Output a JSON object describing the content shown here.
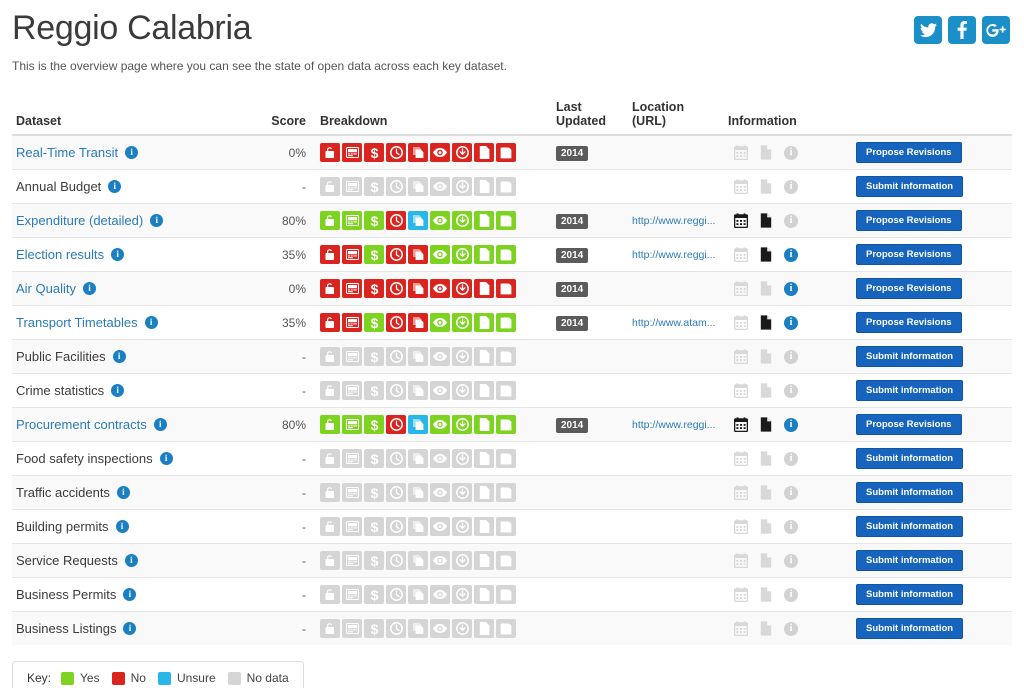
{
  "header": {
    "title": "Reggio Calabria",
    "intro": "This is the overview page where you can see the state of open data across each key dataset.",
    "social": [
      {
        "name": "twitter-icon",
        "label": "Twitter"
      },
      {
        "name": "facebook-icon",
        "label": "Facebook"
      },
      {
        "name": "googleplus-icon",
        "label": "Google Plus"
      }
    ]
  },
  "colors": {
    "yes": "#7ed321",
    "no": "#d9241f",
    "unsure": "#29b6e8",
    "none": "#d5d5d5",
    "accent": "#1664bd",
    "link": "#2b7bb9"
  },
  "table": {
    "columns": [
      {
        "key": "dataset",
        "label": "Dataset"
      },
      {
        "key": "score",
        "label": "Score"
      },
      {
        "key": "breakdown",
        "label": "Breakdown"
      },
      {
        "key": "updated",
        "label": "Last Updated"
      },
      {
        "key": "url",
        "label": "Location (URL)"
      },
      {
        "key": "information",
        "label": "Information"
      },
      {
        "key": "action",
        "label": ""
      }
    ],
    "breakdown_icons": [
      "padlock-open-icon",
      "machine-readable-icon",
      "dollar-icon",
      "clock-icon",
      "license-copy-icon",
      "eye-icon",
      "download-icon",
      "document-icon",
      "save-disk-icon"
    ],
    "rows": [
      {
        "dataset": "Real-Time Transit",
        "is_link": true,
        "score": "0%",
        "breakdown": [
          "no",
          "no",
          "no",
          "no",
          "no",
          "no",
          "no",
          "no",
          "no"
        ],
        "updated": "2014",
        "url": "",
        "information": [
          "off",
          "off",
          "off"
        ],
        "action": "Propose Revisions"
      },
      {
        "dataset": "Annual Budget",
        "is_link": false,
        "score": "-",
        "breakdown": [
          "none",
          "none",
          "none",
          "none",
          "none",
          "none",
          "none",
          "none",
          "none"
        ],
        "updated": "",
        "url": "",
        "information": [
          "off",
          "off",
          "off"
        ],
        "action": "Submit information"
      },
      {
        "dataset": "Expenditure (detailed)",
        "is_link": true,
        "score": "80%",
        "breakdown": [
          "yes",
          "yes",
          "yes",
          "no",
          "unsure",
          "yes",
          "yes",
          "yes",
          "yes"
        ],
        "updated": "2014",
        "url": "http://www.reggi...",
        "information": [
          "on",
          "on",
          "off"
        ],
        "action": "Propose Revisions"
      },
      {
        "dataset": "Election results",
        "is_link": true,
        "score": "35%",
        "breakdown": [
          "no",
          "no",
          "yes",
          "no",
          "no",
          "yes",
          "yes",
          "yes",
          "yes"
        ],
        "updated": "2014",
        "url": "http://www.reggi...",
        "information": [
          "off",
          "on",
          "on"
        ],
        "action": "Propose Revisions"
      },
      {
        "dataset": "Air Quality",
        "is_link": true,
        "score": "0%",
        "breakdown": [
          "no",
          "no",
          "no",
          "no",
          "no",
          "no",
          "no",
          "no",
          "no"
        ],
        "updated": "2014",
        "url": "",
        "information": [
          "off",
          "off",
          "on"
        ],
        "action": "Propose Revisions"
      },
      {
        "dataset": "Transport Timetables",
        "is_link": true,
        "score": "35%",
        "breakdown": [
          "no",
          "no",
          "yes",
          "no",
          "no",
          "yes",
          "yes",
          "yes",
          "yes"
        ],
        "updated": "2014",
        "url": "http://www.atam...",
        "information": [
          "off",
          "on",
          "on"
        ],
        "action": "Propose Revisions"
      },
      {
        "dataset": "Public Facilities",
        "is_link": false,
        "score": "-",
        "breakdown": [
          "none",
          "none",
          "none",
          "none",
          "none",
          "none",
          "none",
          "none",
          "none"
        ],
        "updated": "",
        "url": "",
        "information": [
          "off",
          "off",
          "off"
        ],
        "action": "Submit information"
      },
      {
        "dataset": "Crime statistics",
        "is_link": false,
        "score": "-",
        "breakdown": [
          "none",
          "none",
          "none",
          "none",
          "none",
          "none",
          "none",
          "none",
          "none"
        ],
        "updated": "",
        "url": "",
        "information": [
          "off",
          "off",
          "off"
        ],
        "action": "Submit information"
      },
      {
        "dataset": "Procurement contracts",
        "is_link": true,
        "score": "80%",
        "breakdown": [
          "yes",
          "yes",
          "yes",
          "no",
          "unsure",
          "yes",
          "yes",
          "yes",
          "yes"
        ],
        "updated": "2014",
        "url": "http://www.reggi...",
        "information": [
          "on",
          "on",
          "on"
        ],
        "action": "Propose Revisions"
      },
      {
        "dataset": "Food safety inspections",
        "is_link": false,
        "score": "-",
        "breakdown": [
          "none",
          "none",
          "none",
          "none",
          "none",
          "none",
          "none",
          "none",
          "none"
        ],
        "updated": "",
        "url": "",
        "information": [
          "off",
          "off",
          "off"
        ],
        "action": "Submit information"
      },
      {
        "dataset": "Traffic accidents",
        "is_link": false,
        "score": "-",
        "breakdown": [
          "none",
          "none",
          "none",
          "none",
          "none",
          "none",
          "none",
          "none",
          "none"
        ],
        "updated": "",
        "url": "",
        "information": [
          "off",
          "off",
          "off"
        ],
        "action": "Submit information"
      },
      {
        "dataset": "Building permits",
        "is_link": false,
        "score": "-",
        "breakdown": [
          "none",
          "none",
          "none",
          "none",
          "none",
          "none",
          "none",
          "none",
          "none"
        ],
        "updated": "",
        "url": "",
        "information": [
          "off",
          "off",
          "off"
        ],
        "action": "Submit information"
      },
      {
        "dataset": "Service Requests",
        "is_link": false,
        "score": "-",
        "breakdown": [
          "none",
          "none",
          "none",
          "none",
          "none",
          "none",
          "none",
          "none",
          "none"
        ],
        "updated": "",
        "url": "",
        "information": [
          "off",
          "off",
          "off"
        ],
        "action": "Submit information"
      },
      {
        "dataset": "Business Permits",
        "is_link": false,
        "score": "-",
        "breakdown": [
          "none",
          "none",
          "none",
          "none",
          "none",
          "none",
          "none",
          "none",
          "none"
        ],
        "updated": "",
        "url": "",
        "information": [
          "off",
          "off",
          "off"
        ],
        "action": "Submit information"
      },
      {
        "dataset": "Business Listings",
        "is_link": false,
        "score": "-",
        "breakdown": [
          "none",
          "none",
          "none",
          "none",
          "none",
          "none",
          "none",
          "none",
          "none"
        ],
        "updated": "",
        "url": "",
        "information": [
          "off",
          "off",
          "off"
        ],
        "action": "Submit information"
      }
    ]
  },
  "key": {
    "label": "Key:",
    "items": [
      {
        "label": "Yes",
        "color": "#7ed321"
      },
      {
        "label": "No",
        "color": "#d9241f"
      },
      {
        "label": "Unsure",
        "color": "#29b6e8"
      },
      {
        "label": "No data",
        "color": "#d5d5d5"
      }
    ]
  },
  "info_icon_names": [
    "calendar-icon",
    "document-icon",
    "info-circle-icon"
  ]
}
